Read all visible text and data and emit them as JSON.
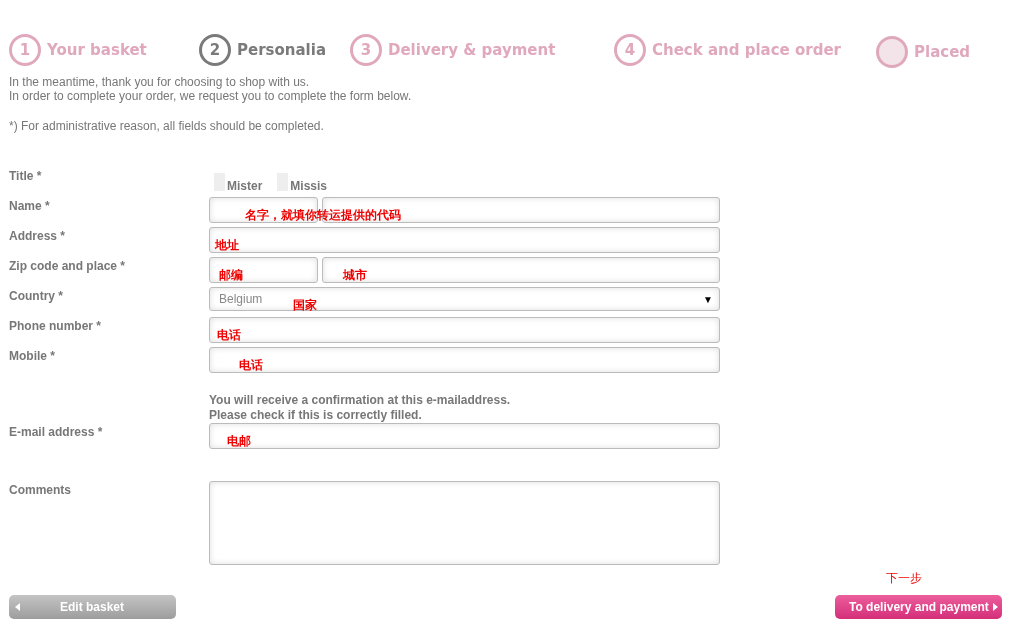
{
  "steps": [
    {
      "number": "1",
      "label": "Your basket",
      "current": false
    },
    {
      "number": "2",
      "label": "Personalia",
      "current": true
    },
    {
      "number": "3",
      "label": "Delivery & payment",
      "current": false
    },
    {
      "number": "4",
      "label": "Check and place order",
      "current": false
    },
    {
      "label": "Placed",
      "current": false
    }
  ],
  "intro": [
    "In the meantime, thank you for choosing to shop with us.",
    "In order to complete your order, we request you to complete the form below."
  ],
  "notice": "*) For administrative reason, all fields should be completed.",
  "rows": [
    {
      "kind": "radio",
      "label": "Title *",
      "options": [
        {
          "label": "Mister",
          "selected": false
        },
        {
          "label": "Missis",
          "selected": false
        }
      ]
    },
    {
      "kind": "split",
      "label": "Name *",
      "note": "名字，就填你转运提供的代码"
    },
    {
      "kind": "text",
      "label": "Address *",
      "note": "地址"
    },
    {
      "kind": "split",
      "label": "Zip code and place *",
      "note": "邮编",
      "note_2": "城市"
    },
    {
      "kind": "select",
      "label": "Country *",
      "value": "Belgium",
      "arrow": "▼",
      "note": "国家"
    },
    {
      "kind": "text",
      "label": "Phone number *",
      "note": "电话"
    },
    {
      "kind": "text",
      "label": "Mobile *",
      "note": "电话"
    },
    {
      "kind": "info",
      "lines": [
        "You will receive a confirmation at this e-mailaddress.",
        "Please check if this is correctly filled."
      ]
    },
    {
      "kind": "text",
      "label": "E-mail address *",
      "note": "电邮"
    },
    {
      "kind": "textarea",
      "label": "Comments"
    }
  ],
  "next_note": "下一步",
  "back_button": "Edit basket",
  "next_button": "To delivery and payment"
}
